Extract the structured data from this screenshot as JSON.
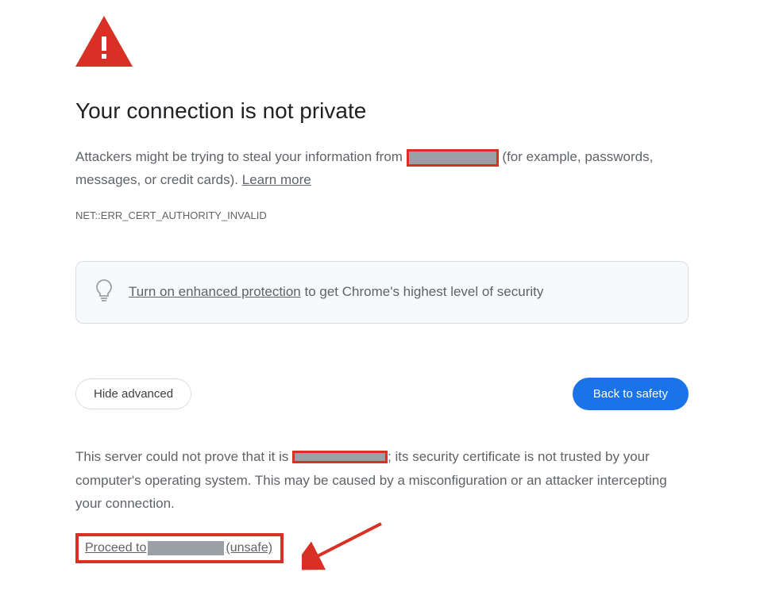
{
  "heading": "Your connection is not private",
  "description_prefix": "Attackers might be trying to steal your information from ",
  "description_suffix": " (for example, passwords, messages, or credit cards). ",
  "learn_more": "Learn more",
  "error_code": "NET::ERR_CERT_AUTHORITY_INVALID",
  "protection": {
    "link_text": "Turn on enhanced protection",
    "suffix_text": " to get Chrome's highest level of security"
  },
  "buttons": {
    "hide_advanced": "Hide advanced",
    "back_to_safety": "Back to safety"
  },
  "advanced_prefix": "This server could not prove that it is ",
  "advanced_suffix": "; its security certificate is not trusted by your computer's operating system. This may be caused by a misconfiguration or an attacker intercepting your connection.",
  "proceed_prefix": "Proceed to ",
  "proceed_suffix": " (unsafe)"
}
